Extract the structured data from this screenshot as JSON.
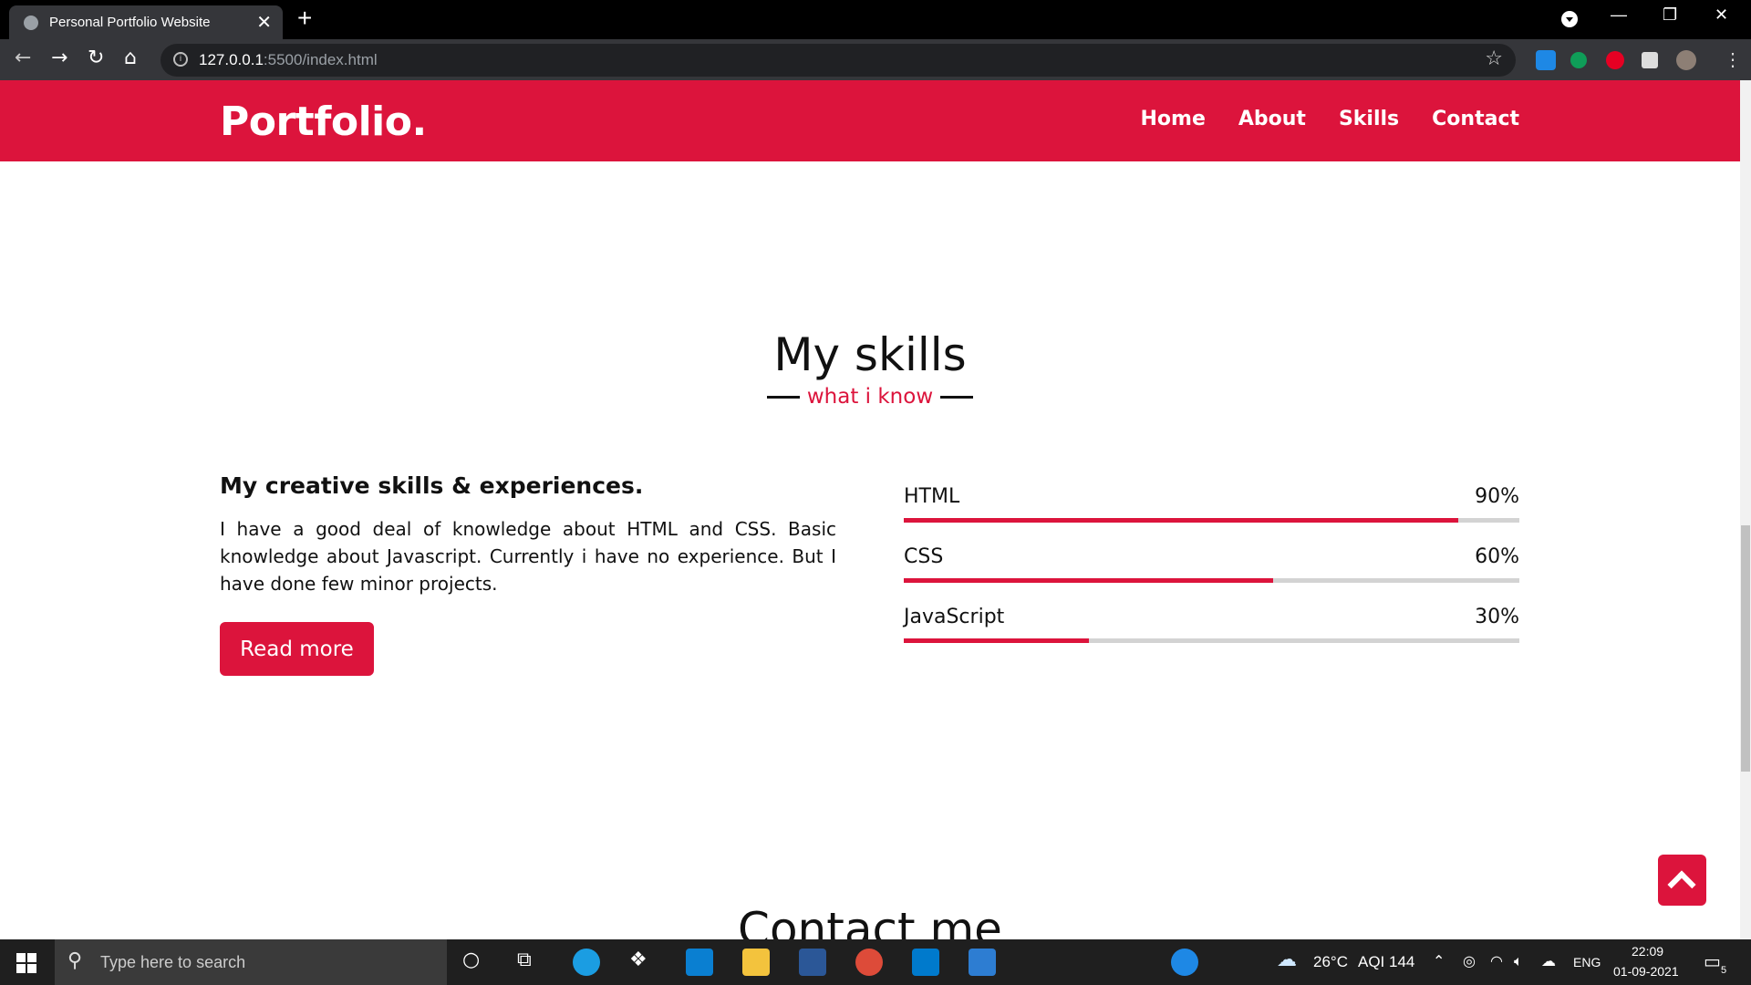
{
  "browser": {
    "tab_title": "Personal Portfolio Website",
    "tab_close": "✕",
    "new_tab": "+",
    "url_host": "127.0.0.1",
    "url_path": ":5500/index.html",
    "info_icon": "i",
    "star_icon": "☆",
    "back": "←",
    "forward": "→",
    "reload": "↻",
    "home": "⌂",
    "minimize": "—",
    "restore": "❐",
    "close": "✕",
    "menu": "⋮"
  },
  "navbar": {
    "logo": "Portfolio.",
    "items": [
      {
        "label": "Home"
      },
      {
        "label": "About"
      },
      {
        "label": "Skills"
      },
      {
        "label": "Contact"
      }
    ]
  },
  "skills_section": {
    "title": "My skills",
    "subtitle": "what i know",
    "heading": "My creative skills & experiences.",
    "paragraph": "I have a good deal of knowledge about HTML and CSS. Basic knowledge about Javascript. Currently i have no experience. But I have done few minor projects.",
    "button": "Read more",
    "skills": [
      {
        "name": "HTML",
        "percent_label": "90%",
        "percent": 90
      },
      {
        "name": "CSS",
        "percent_label": "60%",
        "percent": 60
      },
      {
        "name": "JavaScript",
        "percent_label": "30%",
        "percent": 30
      }
    ]
  },
  "contact_section": {
    "title": "Contact me"
  },
  "taskbar": {
    "search_placeholder": "Type here to search",
    "weather": "26°C",
    "aqi": "AQI 144",
    "language": "ENG",
    "time": "22:09",
    "date": "01-09-2021",
    "notification_count": "5"
  },
  "colors": {
    "accent": "#dc143c"
  }
}
